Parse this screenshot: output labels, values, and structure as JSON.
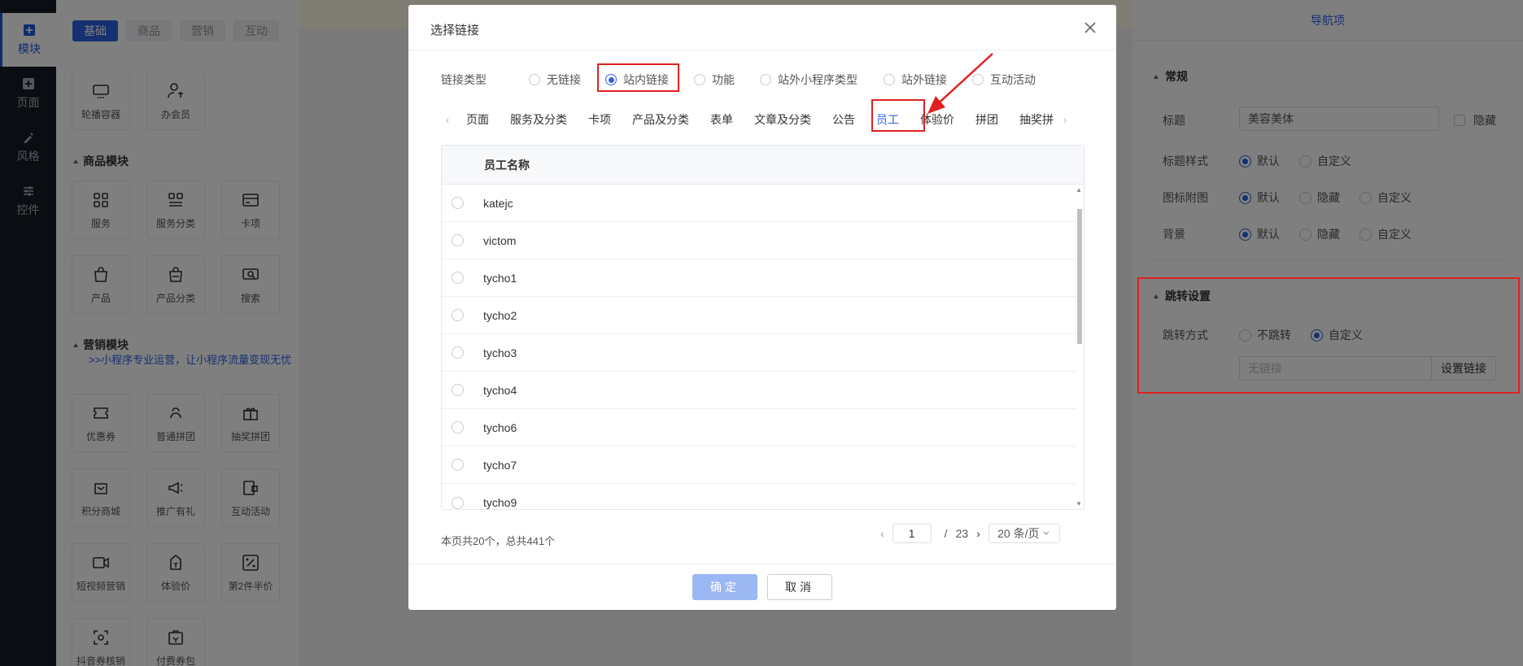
{
  "leftnav": {
    "items": [
      {
        "label": "模块",
        "icon": "plus-square-icon",
        "active": true
      },
      {
        "label": "页面",
        "icon": "plus-square-icon",
        "active": false
      },
      {
        "label": "风格",
        "icon": "brush-icon",
        "active": false
      },
      {
        "label": "控件",
        "icon": "sliders-icon",
        "active": false
      }
    ]
  },
  "modules": {
    "tabs": [
      "基础",
      "商品",
      "营销",
      "互动"
    ],
    "basic": [
      {
        "label": "轮播容器",
        "icon": "carousel-icon"
      },
      {
        "label": "办会员",
        "icon": "member-icon"
      }
    ],
    "goods_title": "商品模块",
    "goods": [
      {
        "label": "服务",
        "icon": "grid-icon"
      },
      {
        "label": "服务分类",
        "icon": "category-icon"
      },
      {
        "label": "卡项",
        "icon": "card-icon"
      },
      {
        "label": "产品",
        "icon": "bag-icon"
      },
      {
        "label": "产品分类",
        "icon": "bag-category-icon"
      },
      {
        "label": "搜索",
        "icon": "search-icon"
      }
    ],
    "marketing_title": "营销模块",
    "promo_text": ">>小程序专业运营，让小程序流量变现无忧",
    "marketing": [
      {
        "label": "优惠券",
        "icon": "coupon-icon"
      },
      {
        "label": "普通拼团",
        "icon": "group-buy-icon"
      },
      {
        "label": "抽奖拼团",
        "icon": "gift-icon"
      },
      {
        "label": "积分商城",
        "icon": "points-mall-icon"
      },
      {
        "label": "推广有礼",
        "icon": "megaphone-icon"
      },
      {
        "label": "互动活动",
        "icon": "interactive-icon"
      },
      {
        "label": "短视频营销",
        "icon": "video-icon"
      },
      {
        "label": "体验价",
        "icon": "price-tag-icon"
      },
      {
        "label": "第2件半价",
        "icon": "percent-icon"
      },
      {
        "label": "抖音券核销",
        "icon": "scan-icon"
      },
      {
        "label": "付费券包",
        "icon": "coupon-pack-icon"
      }
    ]
  },
  "rightpanel": {
    "header": "导航项",
    "general_title": "常规",
    "title_label": "标题",
    "title_value": "美容美体",
    "hide_label": "隐藏",
    "title_style_label": "标题样式",
    "title_style_options": [
      "默认",
      "自定义"
    ],
    "icon_label": "图标附图",
    "icon_options": [
      "默认",
      "隐藏",
      "自定义"
    ],
    "bg_label": "背景",
    "bg_options": [
      "默认",
      "隐藏",
      "自定义"
    ],
    "jump_title": "跳转设置",
    "jump_label": "跳转方式",
    "jump_options": [
      "不跳转",
      "自定义"
    ],
    "link_placeholder": "无链接",
    "set_link_button": "设置链接"
  },
  "modal": {
    "title": "选择链接",
    "link_type_label": "链接类型",
    "link_types": [
      "无链接",
      "站内链接",
      "功能",
      "站外小程序类型",
      "站外链接",
      "互动活动"
    ],
    "selected_link_type": "站内链接",
    "categories": [
      "页面",
      "服务及分类",
      "卡项",
      "产品及分类",
      "表单",
      "文章及分类",
      "公告",
      "员工",
      "体验价",
      "拼团",
      "抽奖拼"
    ],
    "active_category": "员工",
    "table": {
      "header": "员工名称",
      "rows": [
        "katejc",
        "victom",
        "tycho1",
        "tycho2",
        "tycho3",
        "tycho4",
        "tycho6",
        "tycho7",
        "tycho9"
      ]
    },
    "summary": "本页共20个，总共441个",
    "pagination": {
      "current": "1",
      "separator": "/",
      "total": "23",
      "page_size": "20 条/页"
    },
    "ok_button": "确定",
    "cancel_button": "取消"
  }
}
